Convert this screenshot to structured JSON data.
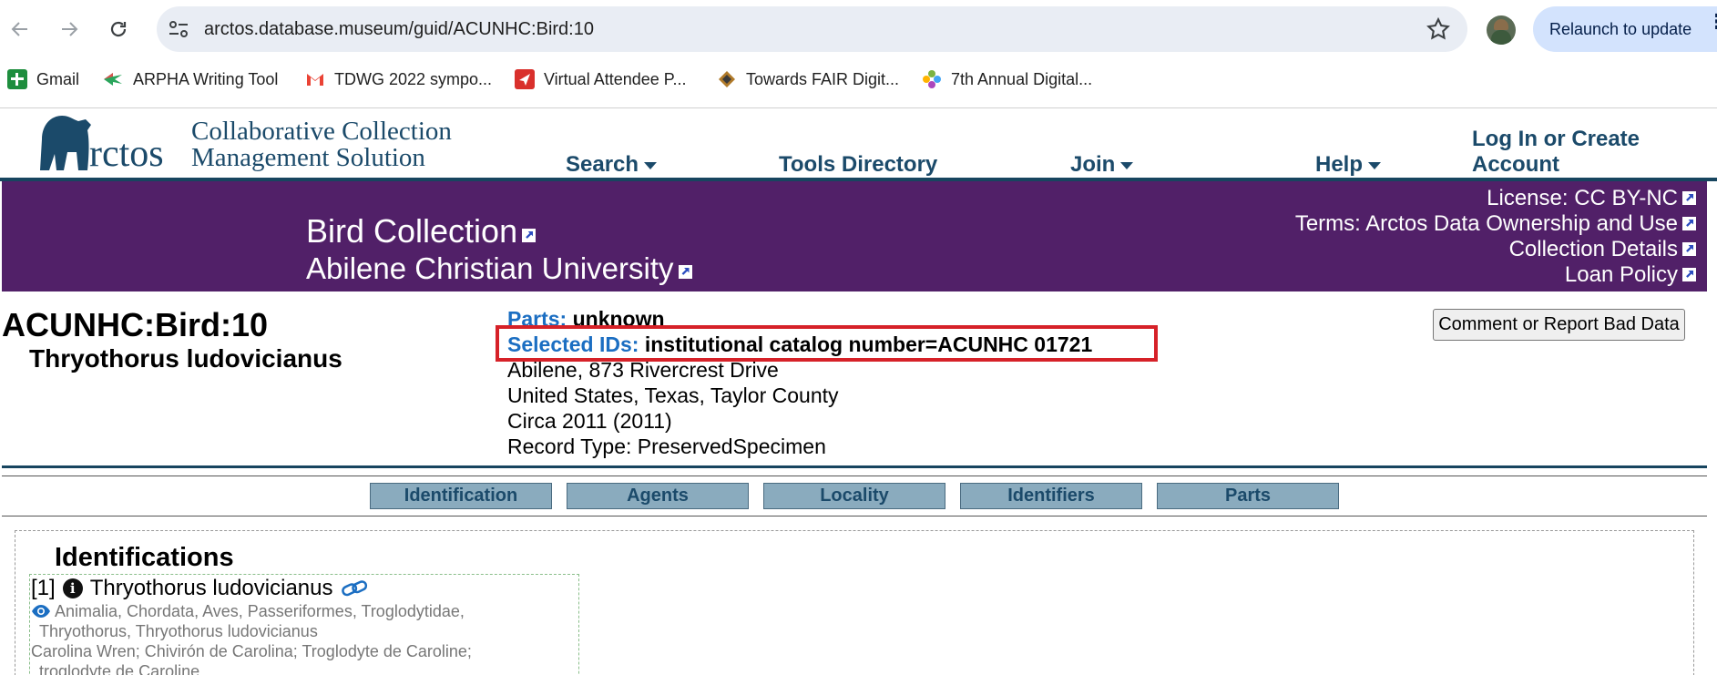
{
  "browser": {
    "url": "arctos.database.museum/guid/ACUNHC:Bird:10",
    "relaunch_label": "Relaunch to update",
    "bookmarks": [
      {
        "label": "Gmail",
        "icon": "gmail-plus-icon"
      },
      {
        "label": "ARPHA Writing Tool",
        "icon": "arpha-icon"
      },
      {
        "label": "TDWG 2022 sympo...",
        "icon": "gmail-m-icon"
      },
      {
        "label": "Virtual Attendee P...",
        "icon": "red-arrow-icon"
      },
      {
        "label": "Towards FAIR Digit...",
        "icon": "fair-icon"
      },
      {
        "label": "7th Annual Digital...",
        "icon": "flower-icon"
      }
    ]
  },
  "site": {
    "logo_word": "rctos",
    "logo_line1": "Collaborative Collection",
    "logo_line2": "Management Solution",
    "nav": {
      "search": "Search",
      "tools": "Tools Directory",
      "join": "Join",
      "help": "Help",
      "login": "Log In or Create Account"
    }
  },
  "collection": {
    "name": "Bird Collection",
    "institution": "Abilene Christian University",
    "license": "License: CC BY-NC",
    "terms": "Terms: Arctos Data Ownership and Use",
    "details": "Collection Details",
    "loan_policy": "Loan Policy",
    "banner_color": "#512068"
  },
  "record": {
    "catalog_number": "ACUNHC:Bird:10",
    "scientific_name": "Thryothorus ludovicianus",
    "parts_label": "Parts:",
    "parts_value": "unknown",
    "ids_label": "Selected IDs:",
    "ids_value": "institutional catalog number=ACUNHC 01721",
    "locality": "Abilene, 873 Rivercrest Drive",
    "geography": "United States, Texas, Taylor County",
    "date": "Circa 2011 (2011)",
    "record_type": "Record Type: PreservedSpecimen",
    "report_button": "Comment or Report Bad Data"
  },
  "tabs": [
    "Identification",
    "Agents",
    "Locality",
    "Identifiers",
    "Parts"
  ],
  "identifications": {
    "title": "Identifications",
    "index": "[1]",
    "name": "Thryothorus ludovicianus",
    "taxonomy_line1": "Animalia, Chordata, Aves, Passeriformes, Troglodytidae,",
    "taxonomy_line2": "Thryothorus, Thryothorus ludovicianus",
    "common_line1": "Carolina Wren; Chivirón de Carolina; Troglodyte de Caroline;",
    "common_line2": "troglodyte de Caroline"
  }
}
